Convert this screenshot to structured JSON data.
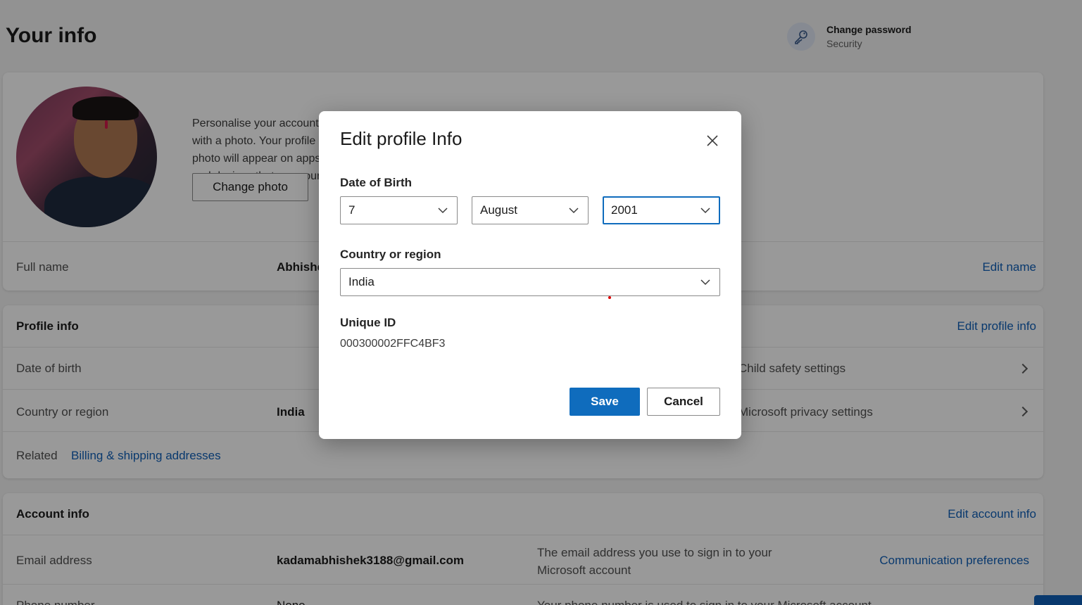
{
  "page": {
    "title": "Your info"
  },
  "quick_link": {
    "title": "Change password",
    "subtitle": "Security",
    "icon": "key-icon"
  },
  "photo_card": {
    "description": "Personalise your account with a photo. Your profile photo will appear on apps and devices that use your Microsoft account.",
    "change_photo_label": "Change photo",
    "full_name_label": "Full name",
    "full_name_value": "Abhishek Kadam",
    "edit_name_label": "Edit name"
  },
  "profile_card": {
    "title": "Profile info",
    "edit_label": "Edit profile info",
    "dob_label": "Date of birth",
    "country_label": "Country or region",
    "country_value": "India",
    "safety_settings": "Child safety settings",
    "privacy_settings": "Microsoft privacy settings",
    "related_label": "Related",
    "billing_link": "Billing & shipping addresses"
  },
  "account_card": {
    "title": "Account info",
    "edit_label": "Edit account info",
    "email_label": "Email address",
    "email_value": "kadamabhishek3188@gmail.com",
    "email_note": "The email address you use to sign in to your Microsoft account",
    "comm_prefs": "Communication preferences",
    "phone_label": "Phone number",
    "phone_value": "None",
    "phone_note": "Your phone number is used to sign in to your Microsoft account"
  },
  "dialog": {
    "title": "Edit profile Info",
    "dob_label": "Date of Birth",
    "day": "7",
    "month": "August",
    "year": "2001",
    "country_label": "Country or region",
    "country": "India",
    "uid_label": "Unique ID",
    "uid_value": "000300002FFC4BF3",
    "save_label": "Save",
    "cancel_label": "Cancel"
  },
  "colors": {
    "accent": "#0f6cbd",
    "link": "#0f5fb8",
    "overlay": "rgba(0,0,0,0.4)"
  }
}
